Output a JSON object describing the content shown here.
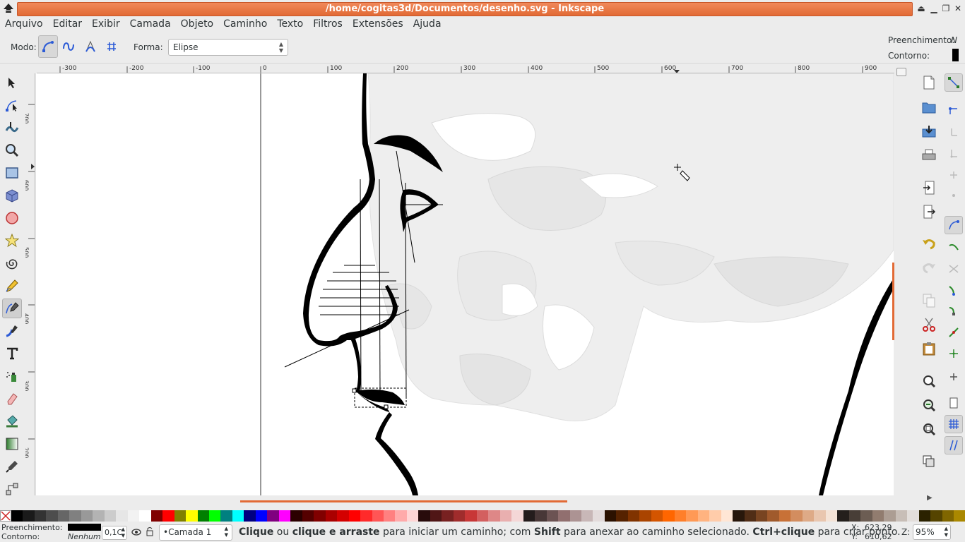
{
  "window": {
    "title": "/home/cogitas3d/Documentos/desenho.svg - Inkscape"
  },
  "menu": [
    "Arquivo",
    "Editar",
    "Exibir",
    "Camada",
    "Objeto",
    "Caminho",
    "Texto",
    "Filtros",
    "Extensões",
    "Ajuda"
  ],
  "tool_controls": {
    "mode_label": "Modo:",
    "shape_label": "Forma:",
    "shape_value": "Elipse",
    "fill_label": "Preenchimento:",
    "fill_value": "N",
    "stroke_label": "Contorno:"
  },
  "ruler": {
    "h_ticks": [
      "-300",
      "-200",
      "-100",
      "0",
      "100",
      "200",
      "300",
      "400",
      "500",
      "600",
      "700",
      "800",
      "900"
    ],
    "v_ticks": [
      "700",
      "600",
      "500",
      "400",
      "300",
      "200"
    ]
  },
  "status": {
    "fill_label": "Preenchimento:",
    "stroke_label": "Contorno:",
    "stroke_value": "Nenhum",
    "opacity_value": "0,1C",
    "layer_name": "•Camada 1",
    "message_parts": [
      {
        "text": "Clique",
        "bold": true
      },
      {
        "text": " ou ",
        "bold": false
      },
      {
        "text": "clique e arraste",
        "bold": true
      },
      {
        "text": " para iniciar um caminho; com ",
        "bold": false
      },
      {
        "text": "Shift",
        "bold": true
      },
      {
        "text": " para anexar ao caminho selecionado. ",
        "bold": false
      },
      {
        "text": "Ctrl+clique",
        "bold": true
      },
      {
        "text": " para criar ponto.",
        "bold": false
      }
    ],
    "x_label": "X:",
    "x_value": "623,29",
    "y_label": "Y:",
    "y_value": "610,62",
    "zoom_label": "Z:",
    "zoom_value": "95%"
  },
  "colors": {
    "title_accent": "#e26a35",
    "palette": [
      "#000000",
      "#1a1a1a",
      "#333333",
      "#4d4d4d",
      "#666666",
      "#808080",
      "#999999",
      "#b3b3b3",
      "#cccccc",
      "#e6e6e6",
      "#f2f2f2",
      "#ffffff",
      "#800000",
      "#ff0000",
      "#808000",
      "#ffff00",
      "#008000",
      "#00ff00",
      "#008080",
      "#00ffff",
      "#000080",
      "#0000ff",
      "#800080",
      "#ff00ff",
      "#2b0000",
      "#550000",
      "#800000",
      "#aa0000",
      "#d40000",
      "#ff0000",
      "#ff2a2a",
      "#ff5555",
      "#ff8080",
      "#ffaaaa",
      "#ffd5d5",
      "#280b0b",
      "#501616",
      "#782121",
      "#a02c2c",
      "#c83737",
      "#d35f5f",
      "#de8787",
      "#e9afaf",
      "#f4d7d7",
      "#241c1c",
      "#483737",
      "#6c5353",
      "#916f6f",
      "#ac9393",
      "#c8b7b7",
      "#e3dbdb",
      "#2b1100",
      "#552200",
      "#803300",
      "#aa4400",
      "#d45500",
      "#ff6600",
      "#ff7f2a",
      "#ff9955",
      "#ffb380",
      "#ffccaa",
      "#ffe6d5",
      "#28170b",
      "#502d16",
      "#784421",
      "#a05a2c",
      "#c87137",
      "#d38d5f",
      "#deaa87",
      "#e9c6af",
      "#f4e3d7",
      "#241f1c",
      "#483e37",
      "#6c5d53",
      "#917c6f",
      "#ac9d93",
      "#c8beb7",
      "#e3dedb",
      "#2b2200",
      "#554400",
      "#806600",
      "#aa8800"
    ]
  },
  "icons": {
    "tools": [
      "selector-arrow-icon",
      "node-tool-icon",
      "tweak-tool-icon",
      "zoom-icon",
      "rectangle-icon",
      "3d-box-icon",
      "ellipse-icon",
      "star-icon",
      "spiral-icon",
      "pencil-icon",
      "pen-bezier-icon",
      "calligraphy-icon",
      "text-icon",
      "spray-icon",
      "eraser-icon",
      "paint-bucket-icon",
      "gradient-icon",
      "dropper-icon",
      "connector-icon"
    ],
    "commands": [
      "new-document-icon",
      "open-icon",
      "save-icon",
      "print-icon",
      "import-icon",
      "export-icon",
      "undo-icon",
      "redo-icon",
      "copy-icon",
      "cut-icon",
      "paste-icon",
      "zoom-selection-icon",
      "zoom-drawing-icon",
      "zoom-page-icon",
      "duplicate-icon"
    ]
  }
}
